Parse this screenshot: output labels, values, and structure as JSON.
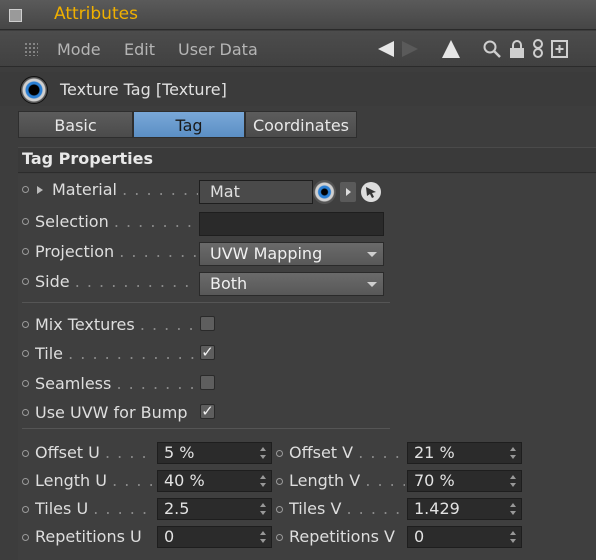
{
  "window": {
    "title": "Attributes"
  },
  "menu": {
    "items": [
      "Mode",
      "Edit",
      "User Data"
    ]
  },
  "toolbar": {
    "icons": [
      "arrow-left-icon",
      "arrow-right-icon",
      "arrow-up-icon",
      "search-icon",
      "lock-icon",
      "link-icon",
      "new-panel-icon"
    ]
  },
  "tag": {
    "title": "Texture Tag [Texture]"
  },
  "tabs": [
    {
      "label": "Basic",
      "active": false
    },
    {
      "label": "Tag",
      "active": true
    },
    {
      "label": "Coordinates",
      "active": false
    }
  ],
  "section": {
    "title": "Tag Properties"
  },
  "props": {
    "material": {
      "label": "Material",
      "dots": ". . . . . . . .",
      "value": "Mat"
    },
    "selection": {
      "label": "Selection",
      "dots": ". . . . . . . .",
      "value": ""
    },
    "projection": {
      "label": "Projection",
      "dots": ". . . . . . . .",
      "value": "UVW Mapping"
    },
    "side": {
      "label": "Side",
      "dots": ". . . . . . . . . . . .",
      "value": "Both"
    },
    "mix_textures": {
      "label": "Mix Textures",
      "dots": ". . . . .",
      "checked": false
    },
    "tile": {
      "label": "Tile",
      "dots": ". . . . . . . . . . . . .",
      "checked": true
    },
    "seamless": {
      "label": "Seamless",
      "dots": ". . . . . . . .",
      "checked": false
    },
    "use_uvw_bump": {
      "label": "Use UVW for Bump",
      "dots": "",
      "checked": true
    }
  },
  "numeric": {
    "offset_u": {
      "label": "Offset U",
      "dots": ". . . .",
      "value": "5 %"
    },
    "offset_v": {
      "label": "Offset V",
      "dots": ". . . .",
      "value": "21 %"
    },
    "length_u": {
      "label": "Length U",
      "dots": ". . . .",
      "value": "40 %"
    },
    "length_v": {
      "label": "Length V",
      "dots": ". . . .",
      "value": "70 %"
    },
    "tiles_u": {
      "label": "Tiles U",
      "dots": ". . . . .",
      "value": "2.5"
    },
    "tiles_v": {
      "label": "Tiles V",
      "dots": ". . . . . .",
      "value": "1.429"
    },
    "repetitions_u": {
      "label": "Repetitions U",
      "dots": "",
      "value": "0"
    },
    "repetitions_v": {
      "label": "Repetitions V",
      "dots": "",
      "value": "0"
    }
  },
  "colors": {
    "title_accent": "#f0b000",
    "tab_active": "#6a9ccf"
  }
}
